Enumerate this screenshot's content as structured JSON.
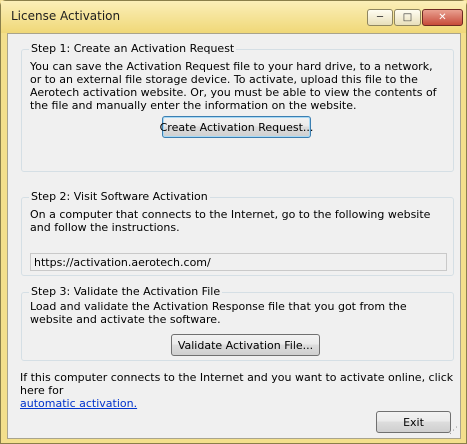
{
  "window": {
    "title": "License Activation",
    "minimize_glyph": "─",
    "maximize_glyph": "□",
    "close_glyph": "✕"
  },
  "step1": {
    "title": "Step 1: Create an Activation Request",
    "description": "You can save the Activation Request file to your hard drive, to a network, or to an external file storage device. To activate, upload this file to the Aerotech activation website. Or, you must be able to view the contents of the file and manually enter the information on the website.",
    "button_label": "Create Activation Request..."
  },
  "step2": {
    "title": "Step 2: Visit Software Activation",
    "description": "On a computer that connects to the Internet, go to the following website and follow the instructions.",
    "url": "https://activation.aerotech.com/"
  },
  "step3": {
    "title": "Step 3: Validate the Activation File",
    "description": "Load and validate the Activation Response file that you got from the website and activate the software.",
    "button_label": "Validate Activation File..."
  },
  "footer": {
    "text": "If this computer connects to the Internet and you want to activate online, click here for",
    "link": "automatic activation.",
    "exit_label": "Exit"
  }
}
